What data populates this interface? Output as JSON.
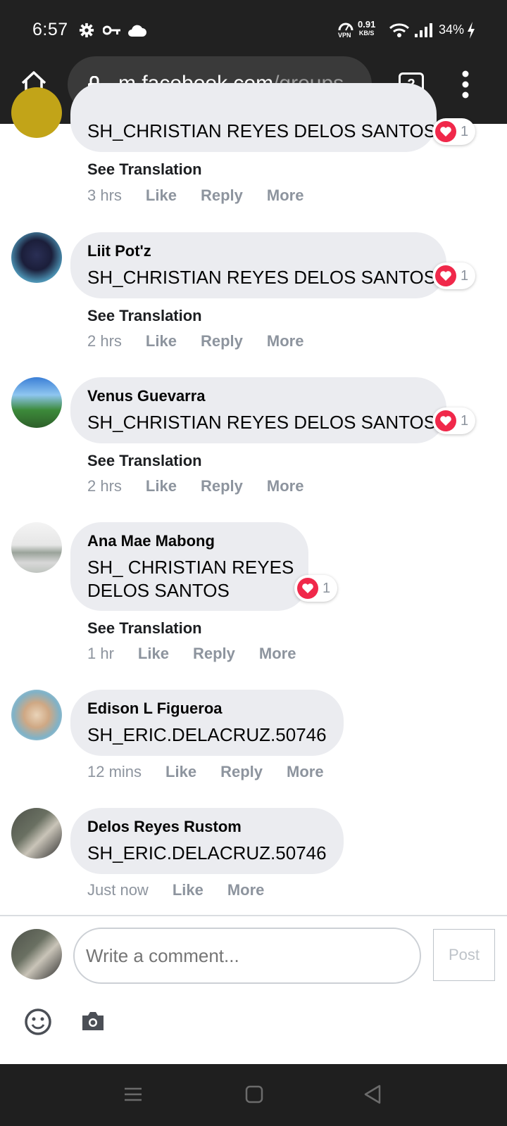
{
  "status_bar": {
    "time": "6:57",
    "vpn": "VPN",
    "speed_value": "0.91",
    "speed_unit": "KB/S",
    "battery": "34%"
  },
  "browser": {
    "url_host": "m.facebook.com",
    "url_path": "/groups",
    "tab_count": "2"
  },
  "comments": [
    {
      "author": "",
      "text": "SH_CHRISTIAN REYES DELOS SANTOS",
      "reactions": "1",
      "see_translation": "See Translation",
      "time": "3 hrs",
      "like": "Like",
      "reply": "Reply",
      "more": "More"
    },
    {
      "author": "Liit Pot'z",
      "text": "SH_CHRISTIAN REYES DELOS SANTOS",
      "reactions": "1",
      "see_translation": "See Translation",
      "time": "2 hrs",
      "like": "Like",
      "reply": "Reply",
      "more": "More"
    },
    {
      "author": "Venus Guevarra",
      "text": "SH_CHRISTIAN REYES DELOS SANTOS",
      "reactions": "1",
      "see_translation": "See Translation",
      "time": "2 hrs",
      "like": "Like",
      "reply": "Reply",
      "more": "More"
    },
    {
      "author": "Ana Mae Mabong",
      "text_line1": "SH_ CHRISTIAN REYES",
      "text_line2": "DELOS SANTOS",
      "reactions": "1",
      "see_translation": "See Translation",
      "time": "1 hr",
      "like": "Like",
      "reply": "Reply",
      "more": "More"
    },
    {
      "author": "Edison L Figueroa",
      "text": "SH_ERIC.DELACRUZ.50746",
      "time": "12 mins",
      "like": "Like",
      "reply": "Reply",
      "more": "More"
    },
    {
      "author": "Delos Reyes Rustom",
      "text": "SH_ERIC.DELACRUZ.50746",
      "time": "Just now",
      "like": "Like",
      "more": "More"
    }
  ],
  "composer": {
    "placeholder": "Write a comment...",
    "post_label": "Post"
  },
  "colors": {
    "bubble": "#ebecf0",
    "heart": "#f0284a",
    "muted": "#8d949e",
    "bar": "#212121"
  }
}
